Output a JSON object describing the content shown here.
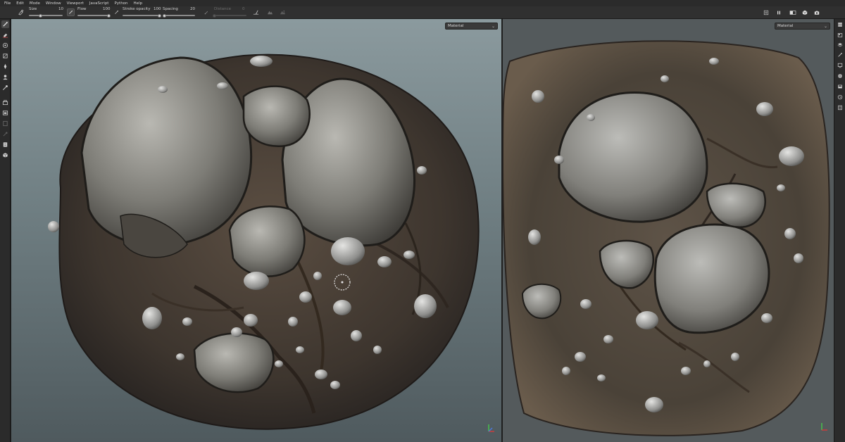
{
  "menu": [
    "File",
    "Edit",
    "Mode",
    "Window",
    "Viewport",
    "JavaScript",
    "Python",
    "Help"
  ],
  "toolbar": {
    "size_label": "Size",
    "size_value": "10",
    "flow_label": "Flow",
    "flow_value": "100",
    "stroke_opacity_label": "Stroke opacity",
    "stroke_opacity_value": "100",
    "spacing_label": "Spacing",
    "spacing_value": "20",
    "distance_label": "Distance",
    "distance_value": "0",
    "size_level": 0.35,
    "flow_level": 1.0,
    "stroke_opacity_level": 1.0,
    "spacing_level": 0.05,
    "distance_level": 0.0
  },
  "left_tools": [
    "paint-brush-icon",
    "eraser-icon",
    "projection-icon",
    "polygon-fill-icon",
    "smudge-icon",
    "clone-icon",
    "color-picker-icon",
    "bake-icon",
    "layer-fill-icon",
    "mask-icon",
    "eyedropper-icon",
    "export-icon",
    "shelf-icon"
  ],
  "right_icons": [
    "texture-set-list-icon",
    "layers-icon",
    "layers-stack-icon",
    "properties-icon",
    "settings-icon",
    "display-settings-icon",
    "viewer-settings-icon",
    "history-icon",
    "log-icon"
  ],
  "view_controls": [
    "camera-frame-icon",
    "pause-icon",
    "split-view-icon",
    "render-icon",
    "screenshot-icon"
  ],
  "viewport3d": {
    "mode": "Material"
  },
  "viewport2d": {
    "mode": "Material"
  },
  "colors": {
    "ui_dark": "#2b2b2b",
    "toolbar": "#303030",
    "bg3d_top": "#8b9a9e",
    "bg3d_bottom": "#4f5a5e",
    "bg2d": "#545a5c",
    "axis_x": "#d23c3c",
    "axis_y": "#46c84a",
    "axis_z": "#4a78dc"
  }
}
